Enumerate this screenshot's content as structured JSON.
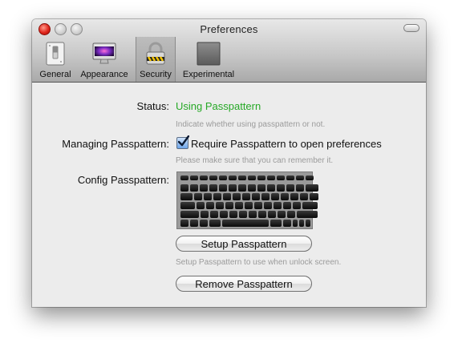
{
  "window": {
    "title": "Preferences"
  },
  "tabs": [
    {
      "label": "General",
      "icon": "switch-icon"
    },
    {
      "label": "Appearance",
      "icon": "monitor-icon"
    },
    {
      "label": "Security",
      "icon": "padlock-icon",
      "selected": true
    },
    {
      "label": "Experimental",
      "icon": "gray-square-icon"
    }
  ],
  "status": {
    "label": "Status:",
    "value": "Using Passpattern",
    "value_color": "#27a927",
    "hint": "Indicate whether using passpattern or not."
  },
  "managing": {
    "label": "Managing Passpattern:",
    "checkbox_label": "Require Passpattern to open preferences",
    "checked": true,
    "hint": "Please make sure that you can remember it."
  },
  "config": {
    "label": "Config Passpattern:",
    "image": "keyboard-image",
    "setup_button": "Setup Passpattern",
    "setup_hint": "Setup Passpattern to use when unlock screen.",
    "remove_button": "Remove Passpattern"
  }
}
